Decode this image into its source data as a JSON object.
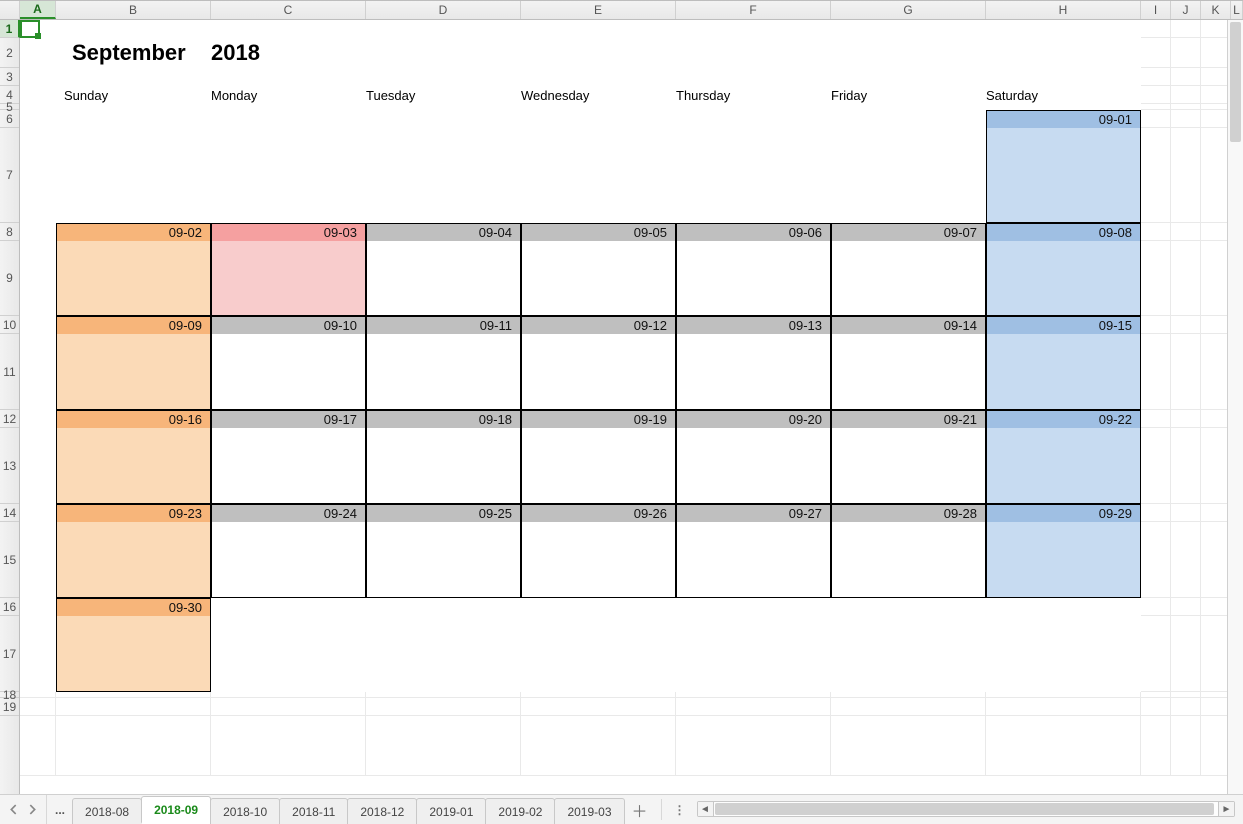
{
  "columns": [
    "A",
    "B",
    "C",
    "D",
    "E",
    "F",
    "G",
    "H",
    "I",
    "J",
    "K",
    "L"
  ],
  "selectedColumn": "A",
  "rows": [
    "1",
    "2",
    "3",
    "4",
    "5",
    "6",
    "7",
    "8",
    "9",
    "10",
    "11",
    "12",
    "13",
    "14",
    "15",
    "16",
    "17",
    "18",
    "19"
  ],
  "rowHeightsPx": [
    18,
    30,
    18,
    18,
    6,
    18,
    95,
    18,
    75,
    18,
    76,
    18,
    76,
    18,
    76,
    18,
    76,
    6,
    18
  ],
  "selectedRow": "1",
  "title": {
    "month": "September",
    "year": "2018"
  },
  "daysOfWeek": [
    "Sunday",
    "Monday",
    "Tuesday",
    "Wednesday",
    "Thursday",
    "Friday",
    "Saturday"
  ],
  "weeks": [
    {
      "dates": [
        "",
        "",
        "",
        "",
        "",
        "",
        "09-01"
      ]
    },
    {
      "dates": [
        "09-02",
        "09-03",
        "09-04",
        "09-05",
        "09-06",
        "09-07",
        "09-08"
      ]
    },
    {
      "dates": [
        "09-09",
        "09-10",
        "09-11",
        "09-12",
        "09-13",
        "09-14",
        "09-15"
      ]
    },
    {
      "dates": [
        "09-16",
        "09-17",
        "09-18",
        "09-19",
        "09-20",
        "09-21",
        "09-22"
      ]
    },
    {
      "dates": [
        "09-23",
        "09-24",
        "09-25",
        "09-26",
        "09-27",
        "09-28",
        "09-29"
      ]
    },
    {
      "dates": [
        "09-30",
        "",
        "",
        "",
        "",
        "",
        ""
      ]
    }
  ],
  "holidayDates": [
    "09-03"
  ],
  "tabs": {
    "ellipsis": "...",
    "items": [
      "2018-08",
      "2018-09",
      "2018-10",
      "2018-11",
      "2018-12",
      "2019-01",
      "2019-02",
      "2019-03"
    ],
    "activeIndex": 1,
    "addIcon": "＋"
  }
}
